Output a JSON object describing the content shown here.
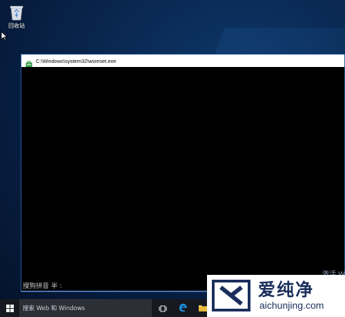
{
  "desktop": {
    "recycle_bin_label": "回收站"
  },
  "cmd_window": {
    "title": "C:\\Windows\\system32\\wsreset.exe",
    "ime_status": "搜狗拼音 半 :"
  },
  "watermark": {
    "activate_text": "激活 W"
  },
  "taskbar": {
    "search_placeholder": "搜索 Web 和 Windows"
  },
  "logo": {
    "brand_cn": "爱纯净",
    "brand_url": "aichunjing.com"
  },
  "colors": {
    "taskbar_bg": "#16191f",
    "search_bg": "#2c2f36",
    "edge_blue": "#1e8ee0",
    "brand_navy": "#1b2f5c"
  }
}
